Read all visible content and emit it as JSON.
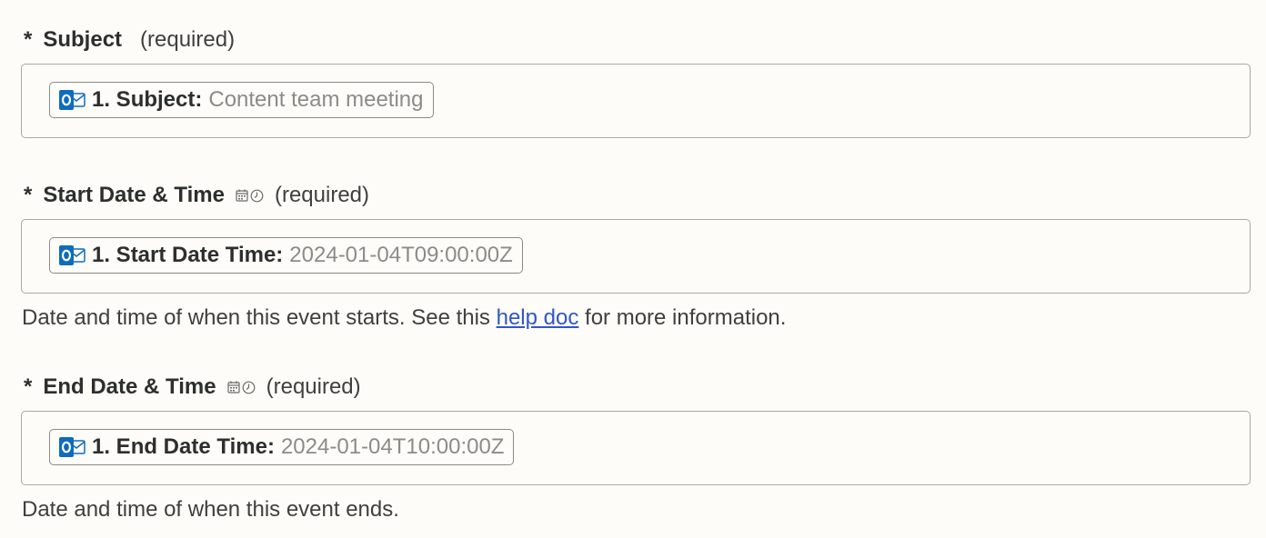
{
  "fields": [
    {
      "asterisk": "*",
      "label": "Subject",
      "required": "(required)",
      "has_datetime_icons": false,
      "pill": {
        "app_icon": "outlook-icon",
        "key": "1. Subject:",
        "value": "Content team meeting"
      }
    },
    {
      "asterisk": "*",
      "label": "Start Date & Time",
      "required": "(required)",
      "has_datetime_icons": true,
      "pill": {
        "app_icon": "outlook-icon",
        "key": "1. Start Date Time:",
        "value": "2024-01-04T09:00:00Z"
      },
      "help": {
        "before": "Date and time of when this event starts. See this ",
        "link": "help doc",
        "after": " for more information."
      }
    },
    {
      "asterisk": "*",
      "label": "End Date & Time",
      "required": "(required)",
      "has_datetime_icons": true,
      "pill": {
        "app_icon": "outlook-icon",
        "key": "1. End Date Time:",
        "value": "2024-01-04T10:00:00Z"
      },
      "help": {
        "text": "Date and time of when this event ends."
      }
    }
  ],
  "colors": {
    "background": "#fdfcf8",
    "text": "#2d2e2e",
    "muted_value": "#8c8b89",
    "link": "#3157c4",
    "outlook_blue": "#0f6cbd"
  }
}
